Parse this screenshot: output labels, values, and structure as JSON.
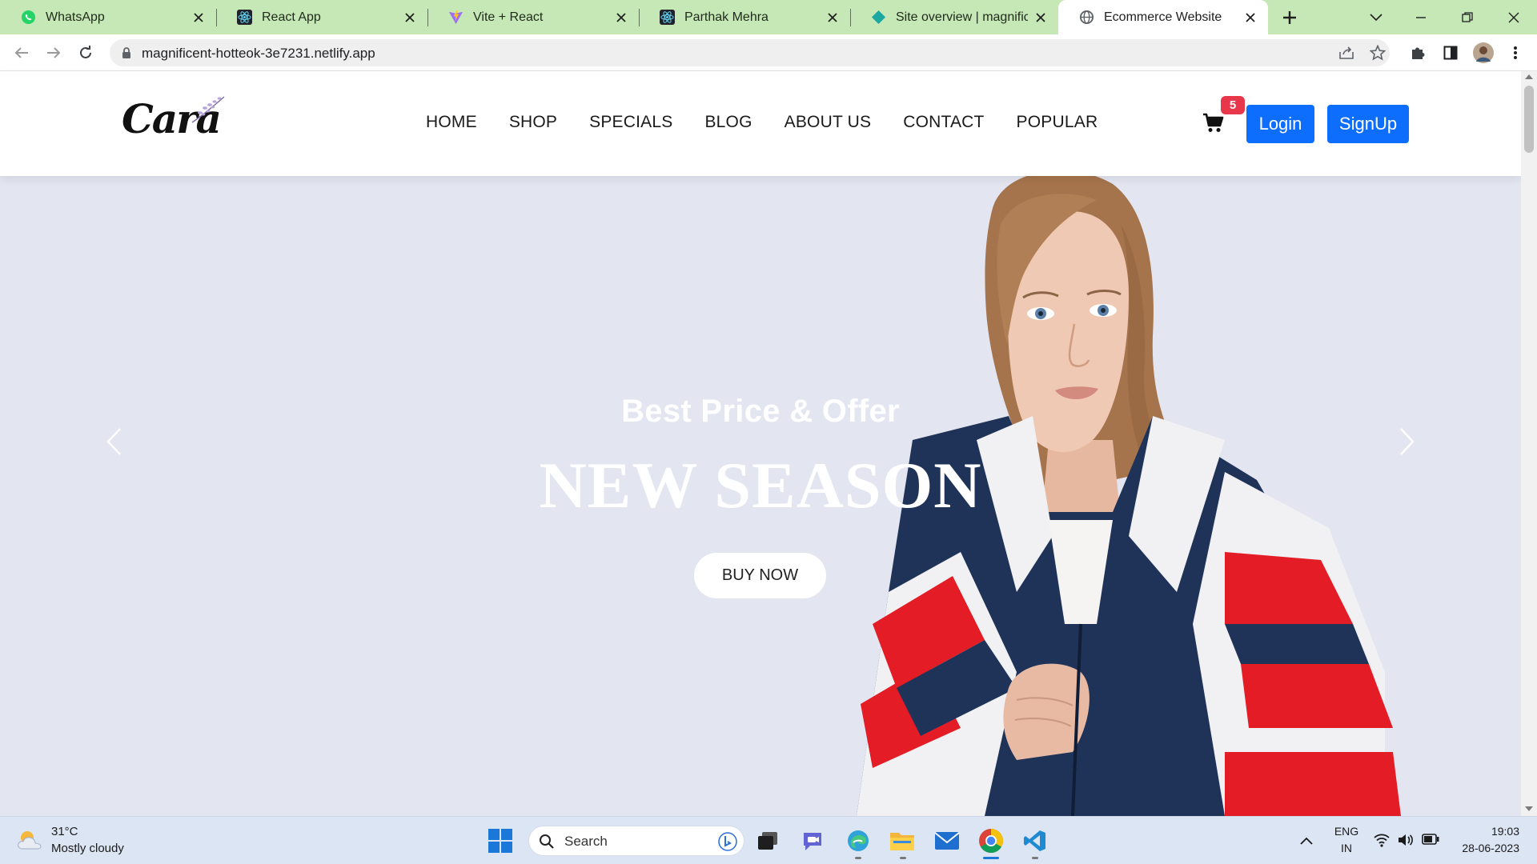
{
  "browser": {
    "tabs": [
      {
        "title": "WhatsApp",
        "icon": "whatsapp-icon"
      },
      {
        "title": "React App",
        "icon": "react-icon"
      },
      {
        "title": "Vite + React",
        "icon": "vite-icon"
      },
      {
        "title": "Parthak Mehra",
        "icon": "react-icon"
      },
      {
        "title": "Site overview | magnificent",
        "icon": "netlify-icon"
      },
      {
        "title": "Ecommerce Website",
        "icon": "globe-icon",
        "active": true
      }
    ],
    "url": "magnificent-hotteok-3e7231.netlify.app"
  },
  "site": {
    "logo_text": "Cara",
    "nav": [
      "HOME",
      "SHOP",
      "SPECIALS",
      "BLOG",
      "ABOUT US",
      "CONTACT",
      "POPULAR"
    ],
    "cart_count": "5",
    "login_label": "Login",
    "signup_label": "SignUp",
    "hero": {
      "subtitle": "Best Price & Offer",
      "title": "NEW SEASON",
      "button_label": "BUY NOW"
    },
    "colors": {
      "primary": "#0d6efd",
      "badge": "#e8364a",
      "hero_bg": "#e3e5f1"
    }
  },
  "taskbar": {
    "weather_temp": "31°C",
    "weather_desc": "Mostly cloudy",
    "search_placeholder": "Search",
    "lang_top": "ENG",
    "lang_bottom": "IN",
    "time": "19:03",
    "date": "28-06-2023"
  }
}
